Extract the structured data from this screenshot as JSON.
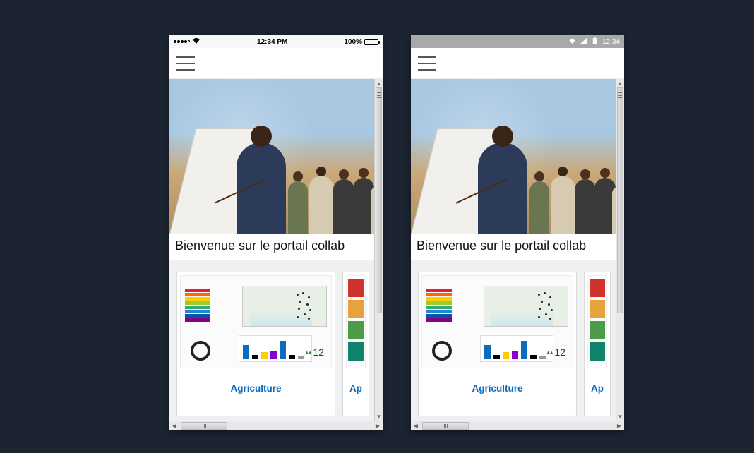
{
  "ios_status": {
    "time": "12:34 PM",
    "battery_pct": "100%"
  },
  "android_status": {
    "time": "12:34"
  },
  "content": {
    "welcome_text": "Bienvenue sur le portail collab",
    "cards": [
      {
        "title": "Agriculture",
        "thumb_number": "12"
      },
      {
        "title_partial": "Ap"
      }
    ],
    "sdg_colors": [
      "#d0332e",
      "#e8a23c",
      "#4b9b48",
      "#11826b"
    ]
  },
  "legend_colors": [
    "#d23",
    "#f60",
    "#fc0",
    "#9c3",
    "#3a7",
    "#28c",
    "#05a",
    "#808"
  ],
  "bar_colors": [
    {
      "c": "#0a6bbf",
      "h": 20
    },
    {
      "c": "#000",
      "h": 6
    },
    {
      "c": "#fc0",
      "h": 10
    },
    {
      "c": "#80c",
      "h": 12
    },
    {
      "c": "#0a6bbf",
      "h": 26
    },
    {
      "c": "#000",
      "h": 6
    },
    {
      "c": "#999",
      "h": 4
    }
  ]
}
